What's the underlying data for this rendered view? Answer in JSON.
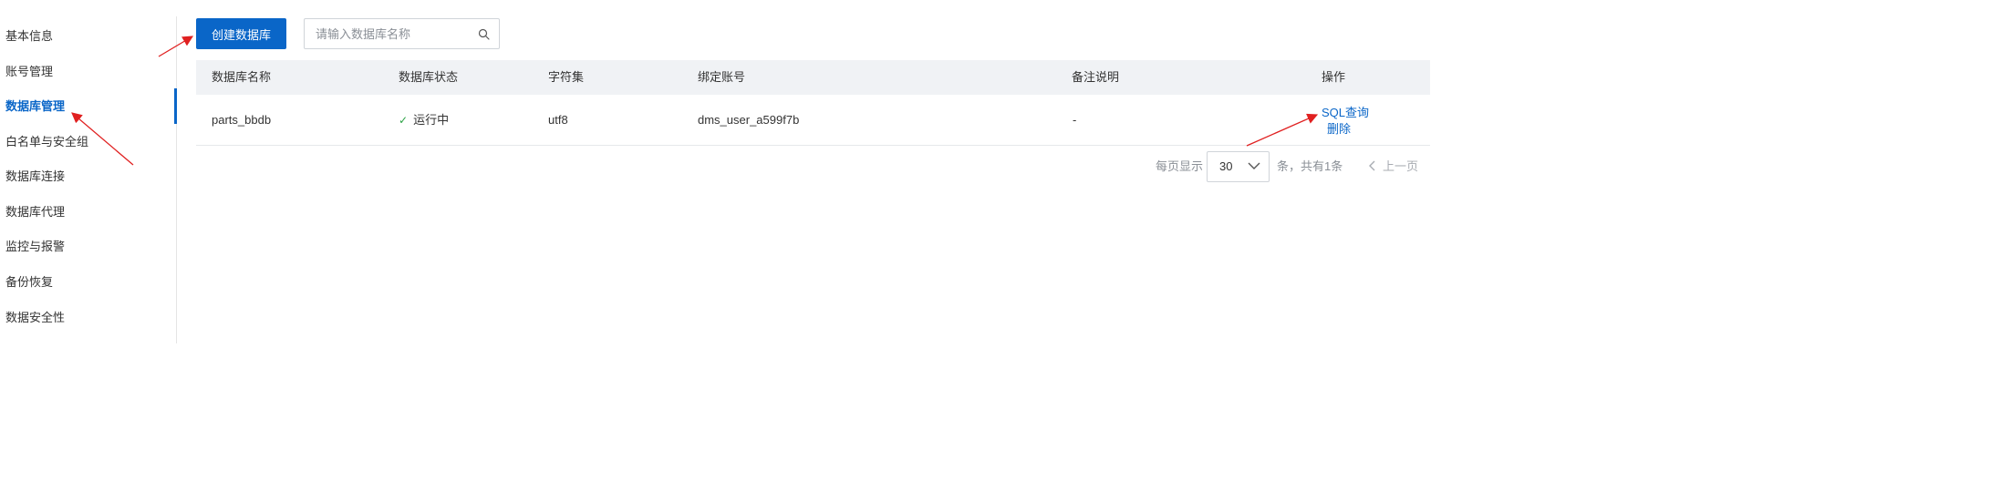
{
  "sidebar": {
    "items": [
      {
        "label": "基本信息"
      },
      {
        "label": "账号管理"
      },
      {
        "label": "数据库管理"
      },
      {
        "label": "白名单与安全组"
      },
      {
        "label": "数据库连接"
      },
      {
        "label": "数据库代理"
      },
      {
        "label": "监控与报警"
      },
      {
        "label": "备份恢复"
      },
      {
        "label": "数据安全性"
      }
    ],
    "active_index": 2
  },
  "toolbar": {
    "create_label": "创建数据库",
    "search_placeholder": "请输入数据库名称",
    "search_value": ""
  },
  "table": {
    "columns": [
      "数据库名称",
      "数据库状态",
      "字符集",
      "绑定账号",
      "备注说明",
      "操作"
    ],
    "rows": [
      {
        "name": "parts_bbdb",
        "status": "运行中",
        "charset": "utf8",
        "account": "dms_user_a599f7b",
        "remark": "-",
        "actions": [
          "SQL查询",
          "删除"
        ]
      }
    ]
  },
  "pagination": {
    "per_page_label": "每页显示",
    "page_size": "30",
    "total_text": "条，共有1条",
    "prev_label": "上一页"
  },
  "colors": {
    "primary": "#0a66c8",
    "success": "#2ba245",
    "annotation": "#e02020"
  }
}
